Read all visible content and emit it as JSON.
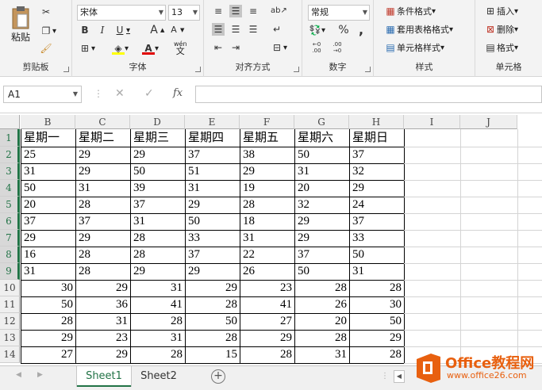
{
  "ribbon": {
    "clipboard": {
      "paste_label": "粘贴",
      "group_label": "剪贴板"
    },
    "font": {
      "font_name": "宋体",
      "font_size": "13",
      "bold": "B",
      "italic": "I",
      "underline": "U",
      "grow": "A",
      "shrink": "A",
      "wen": "wén",
      "group_label": "字体"
    },
    "alignment": {
      "group_label": "对齐方式"
    },
    "number": {
      "format": "常规",
      "percent": "%",
      "comma": ",",
      "group_label": "数字"
    },
    "styles": {
      "conditional": "条件格式",
      "table": "套用表格格式",
      "cell_styles": "单元格样式",
      "group_label": "样式"
    },
    "cells": {
      "insert": "插入",
      "delete": "删除",
      "format": "格式",
      "group_label": "单元格"
    }
  },
  "formula_bar": {
    "name_box": "A1",
    "fx": "fx",
    "formula": ""
  },
  "grid": {
    "columns": [
      "B",
      "C",
      "D",
      "E",
      "F",
      "G",
      "H",
      "I",
      "J"
    ],
    "rows": [
      "1",
      "2",
      "3",
      "4",
      "5",
      "6",
      "7",
      "8",
      "9",
      "10",
      "11",
      "12",
      "13",
      "14"
    ],
    "header_row": [
      "星期一",
      "星期二",
      "星期三",
      "星期四",
      "星期五",
      "星期六",
      "星期日"
    ],
    "text_rows": [
      [
        "25",
        "29",
        "29",
        "37",
        "38",
        "50",
        "37"
      ],
      [
        "31",
        "29",
        "50",
        "51",
        "29",
        "31",
        "32"
      ],
      [
        "50",
        "31",
        "39",
        "31",
        "19",
        "20",
        "29"
      ],
      [
        "20",
        "28",
        "37",
        "29",
        "28",
        "32",
        "24"
      ],
      [
        "37",
        "37",
        "31",
        "50",
        "18",
        "29",
        "37"
      ],
      [
        "29",
        "29",
        "28",
        "33",
        "31",
        "29",
        "33"
      ],
      [
        "16",
        "28",
        "28",
        "37",
        "22",
        "37",
        "50"
      ],
      [
        "31",
        "28",
        "29",
        "29",
        "26",
        "50",
        "31"
      ]
    ],
    "number_rows": [
      [
        30,
        29,
        31,
        29,
        23,
        28,
        28
      ],
      [
        50,
        36,
        41,
        28,
        41,
        26,
        30
      ],
      [
        28,
        31,
        28,
        50,
        27,
        20,
        50
      ],
      [
        29,
        23,
        31,
        28,
        29,
        28,
        29
      ],
      [
        27,
        29,
        28,
        15,
        28,
        31,
        28
      ]
    ]
  },
  "sheets": {
    "tab1": "Sheet1",
    "tab2": "Sheet2",
    "add": "+"
  },
  "watermark": {
    "brand": "Office教程网",
    "url": "www.office26.com"
  },
  "colors": {
    "accent": "#217346",
    "watermark_orange": "#e8600f"
  }
}
